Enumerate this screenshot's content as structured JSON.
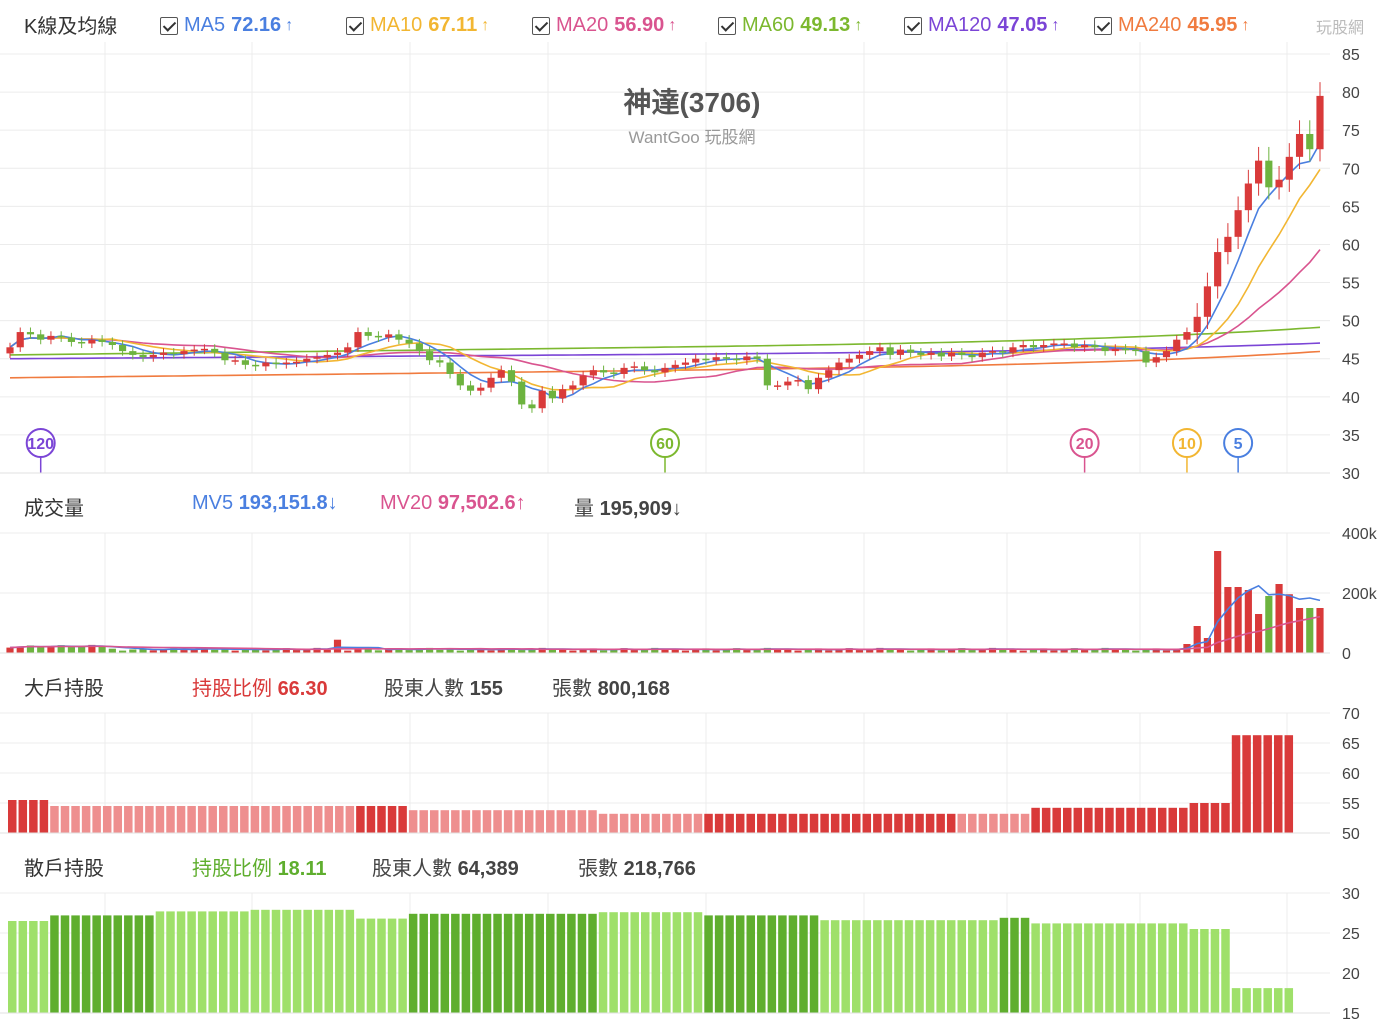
{
  "header": {
    "title": "K線及均線",
    "ma": [
      {
        "name": "MA5",
        "value": "72.16",
        "arrow": "↑",
        "color": "#4a7fe0"
      },
      {
        "name": "MA10",
        "value": "67.11",
        "arrow": "↑",
        "color": "#f2b632"
      },
      {
        "name": "MA20",
        "value": "56.90",
        "arrow": "↑",
        "color": "#d9548f"
      },
      {
        "name": "MA60",
        "value": "49.13",
        "arrow": "↑",
        "color": "#7cb82f"
      },
      {
        "name": "MA120",
        "value": "47.05",
        "arrow": "↑",
        "color": "#7b45d6"
      },
      {
        "name": "MA240",
        "value": "45.95",
        "arrow": "↑",
        "color": "#f07b3f"
      }
    ],
    "logo_text": "玩股網"
  },
  "price_chart": {
    "stock_name": "神達(3706)",
    "watermark": "WantGoo 玩股網",
    "markers": [
      {
        "label": "120",
        "color": "#7b45d6",
        "index": 3
      },
      {
        "label": "60",
        "color": "#7cb82f",
        "index": 64
      },
      {
        "label": "20",
        "color": "#d9548f",
        "index": 105
      },
      {
        "label": "10",
        "color": "#f2b632",
        "index": 115
      },
      {
        "label": "5",
        "color": "#4a7fe0",
        "index": 120
      }
    ]
  },
  "volume_section": {
    "label": "成交量",
    "mv5_label": "MV5",
    "mv5_value": "193,151.8",
    "mv5_arrow": "↓",
    "mv20_label": "MV20",
    "mv20_value": "97,502.6",
    "mv20_arrow": "↑",
    "vol_label": "量",
    "vol_value": "195,909",
    "vol_arrow": "↓"
  },
  "major_section": {
    "label": "大戶持股",
    "ratio_label": "持股比例",
    "ratio_value": "66.30",
    "holders_label": "股東人數",
    "holders_value": "155",
    "shares_label": "張數",
    "shares_value": "800,168"
  },
  "retail_section": {
    "label": "散戶持股",
    "ratio_label": "持股比例",
    "ratio_value": "18.11",
    "holders_label": "股東人數",
    "holders_value": "64,389",
    "shares_label": "張數",
    "shares_value": "218,766"
  },
  "colors": {
    "up": "#d93a3a",
    "down": "#6db33f",
    "major_up": "#d93a3a",
    "major_light": "#ee8f8f",
    "retail_dark": "#5fae2e",
    "retail_light": "#9fe06a",
    "grid": "#ececec",
    "axis_text": "#444"
  },
  "chart_data": [
    {
      "type": "candlestick",
      "title": "K線及均線",
      "ylim": [
        30,
        85
      ],
      "yticks": [
        30,
        35,
        40,
        45,
        50,
        55,
        60,
        65,
        70,
        75,
        80,
        85
      ],
      "series": [
        {
          "name": "MA5",
          "values_end": 72.16
        },
        {
          "name": "MA10",
          "values_end": 67.11
        },
        {
          "name": "MA20",
          "values_end": 56.9
        },
        {
          "name": "MA60",
          "values_end": 49.13
        },
        {
          "name": "MA120",
          "values_end": 47.05
        },
        {
          "name": "MA240",
          "values_end": 45.95
        }
      ],
      "close": [
        46.5,
        48.5,
        48.2,
        47.5,
        48.0,
        47.8,
        47.2,
        47.0,
        47.5,
        47.2,
        46.8,
        46.0,
        45.5,
        45.2,
        45.5,
        45.8,
        45.6,
        46.0,
        46.2,
        46.3,
        45.8,
        44.8,
        44.8,
        44.2,
        44.0,
        44.5,
        44.3,
        44.5,
        44.6,
        45.0,
        45.2,
        45.5,
        45.8,
        46.5,
        48.5,
        48.0,
        47.8,
        48.2,
        47.5,
        47.0,
        46.0,
        44.8,
        44.5,
        43.0,
        41.5,
        40.8,
        41.2,
        42.5,
        43.5,
        42.0,
        39.0,
        38.5,
        40.8,
        39.8,
        41.0,
        41.5,
        42.8,
        43.5,
        43.2,
        43.0,
        43.8,
        44.0,
        43.5,
        43.2,
        43.8,
        44.2,
        44.5,
        45.0,
        44.8,
        45.2,
        45.0,
        44.8,
        45.3,
        45.0,
        41.5,
        41.5,
        42.0,
        42.2,
        41.0,
        42.5,
        43.5,
        44.5,
        45.0,
        45.5,
        46.0,
        46.5,
        45.5,
        46.2,
        45.8,
        45.5,
        45.8,
        45.3,
        45.8,
        45.5,
        45.2,
        45.8,
        46.0,
        45.8,
        46.5,
        46.8,
        46.5,
        46.8,
        47.0,
        47.0,
        46.5,
        46.8,
        46.5,
        46.0,
        46.3,
        46.2,
        46.0,
        44.5,
        45.2,
        46.0,
        47.5,
        48.5,
        50.5,
        54.5,
        59.0,
        61.0,
        64.5,
        68.0,
        71.0,
        67.5,
        68.5,
        71.5,
        74.5,
        72.5,
        79.5
      ],
      "volume_max": 400000,
      "volume_yticks": [
        "0",
        "200k",
        "400k"
      ],
      "major_yticks": [
        50,
        55,
        60,
        65,
        70
      ],
      "major_values_end": 66.3,
      "retail_yticks": [
        15,
        20,
        25,
        30
      ],
      "retail_values_end": 18.11
    }
  ]
}
